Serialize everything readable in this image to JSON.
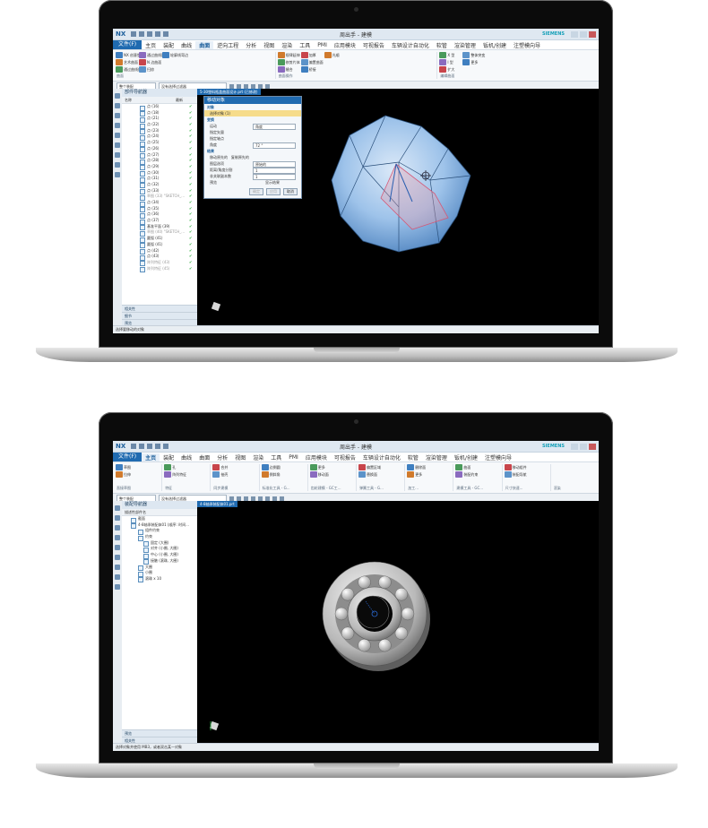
{
  "laptop1": {
    "app": {
      "logo": "NX",
      "window_title": "周出手 - 建模",
      "brand": "SIEMENS",
      "file_tab": "文件(F)",
      "menu_items": [
        "主页",
        "装配",
        "曲线",
        "曲面",
        "逆向工程",
        "分析",
        "视图",
        "渲染",
        "工具",
        "PMI",
        "应用模块",
        "可视报告",
        "车辆设计自动化",
        "软管",
        "渲染管理",
        "钣机/创建",
        "注塑模向导"
      ],
      "active_menu": "曲面",
      "selection_filter": "整个装配",
      "type_filter": "没有选择过滤器"
    },
    "ribbon": {
      "group_labels": [
        "曲面",
        "曲面操作",
        "编辑曲面"
      ],
      "buttons": [
        "NX 创意塑型",
        "艺术曲面",
        "通过曲线组",
        "通过曲线网格",
        "N 边曲面",
        "扫掠",
        "轮廓线弯边",
        "规律延伸",
        "修剪片体",
        "缝合",
        "加厚",
        "偏置曲面",
        "桥接",
        "光顺",
        "X 型",
        "I 型",
        "扩大",
        "整体突变",
        "更多"
      ]
    },
    "nav": {
      "title": "部件导航器",
      "columns": [
        "名称",
        "最新"
      ],
      "items": [
        "点 (16)",
        "点 (18)",
        "点 (21)",
        "点 (22)",
        "点 (23)",
        "点 (24)",
        "点 (25)",
        "点 (26)",
        "点 (27)",
        "点 (28)",
        "点 (29)",
        "点 (30)",
        "点 (31)",
        "点 (32)",
        "点 (33)",
        "草图 (33) \"SKETCH_...",
        "点 (34)",
        "点 (35)",
        "点 (36)",
        "点 (37)",
        "基准平面 (39)",
        "草图 (40) \"SKETCH_...",
        "圆弧 (41)",
        "圆弧 (41)",
        "点 (42)",
        "点 (43)",
        "阵列特征 (43)",
        "阵列特征 (45)"
      ],
      "bottom_sections": [
        "相关性",
        "细节",
        "预览"
      ]
    },
    "tab": "5-30塑料瓶盖曲面设计.prt (已修改)",
    "dialog": {
      "title": "移动对象",
      "sec_object": "对象",
      "select_object": "选择对象 (1)",
      "sec_transform": "变换",
      "motion_label": "运动",
      "motion_value": "角度",
      "vector_label": "指定矢量",
      "axis_point_label": "指定轴点",
      "angle_label": "角度",
      "angle_value": "72",
      "angle_unit": "°",
      "sec_result": "结果",
      "radio_move": "移动原先的",
      "radio_copy": "复制原先的",
      "layer_label": "图层选项",
      "layer_value": "原始的",
      "dist_label": "距离/角度分割",
      "dist_value": "1",
      "copies_label": "非关联副本数",
      "copies_value": "1",
      "preview_label": "预览",
      "show_result": "显示结果",
      "btn_ok": "确定",
      "btn_apply": "应用",
      "btn_cancel": "取消"
    },
    "status": "选择要移动的对象",
    "accent": "#1f6ab0",
    "check_color": "#1ca52b"
  },
  "laptop2": {
    "app": {
      "logo": "NX",
      "window_title": "周出手 - 建模",
      "brand": "SIEMENS",
      "file_tab": "文件(F)",
      "menu_items": [
        "主页",
        "装配",
        "曲线",
        "曲面",
        "分析",
        "视图",
        "渲染",
        "工具",
        "PMI",
        "应用模块",
        "可视报告",
        "车辆设计自动化",
        "软管",
        "渲染管理",
        "钣机/创建",
        "注塑模向导"
      ],
      "active_menu": "主页",
      "selection_filter": "整个装配",
      "type_filter": "没有选择过滤器"
    },
    "ribbon": {
      "group_labels": [
        "直接草图",
        "特征",
        "同步建模",
        "标准化工具 - G...",
        "齿轮建模 - GC工...",
        "弹簧工具 - G...",
        "加工...",
        "建模工具 - GC...",
        "尺寸快速...",
        "渲染"
      ],
      "buttons": [
        "草图",
        "拉伸",
        "孔",
        "阵列特征",
        "合并",
        "抽壳",
        "边倒圆",
        "倒斜角",
        "更多",
        "移动面",
        "偏置区域",
        "替换面",
        "删除面",
        "更多",
        "曲面",
        "装配约束",
        "移动组件",
        "装配导航"
      ]
    },
    "nav": {
      "title": "装配导航器",
      "column": "描述性部件名",
      "items": [
        "截面",
        "4-8轴承装配体01 (顺序: 时间...",
        "组件约束",
        "约束",
        "固定 (大圈)",
        "对齐 (小圈, 大圈)",
        "中心 (小圈, 大圈)",
        "接触 (滚珠, 大圈)",
        "大圈",
        "小圈",
        "滚珠 x 10"
      ],
      "bottom_sections": [
        "预览",
        "相关性"
      ]
    },
    "tab": "4-8轴承装配体01.prt",
    "status": "选择对象并使用 MB3，或者双击某一对象"
  }
}
